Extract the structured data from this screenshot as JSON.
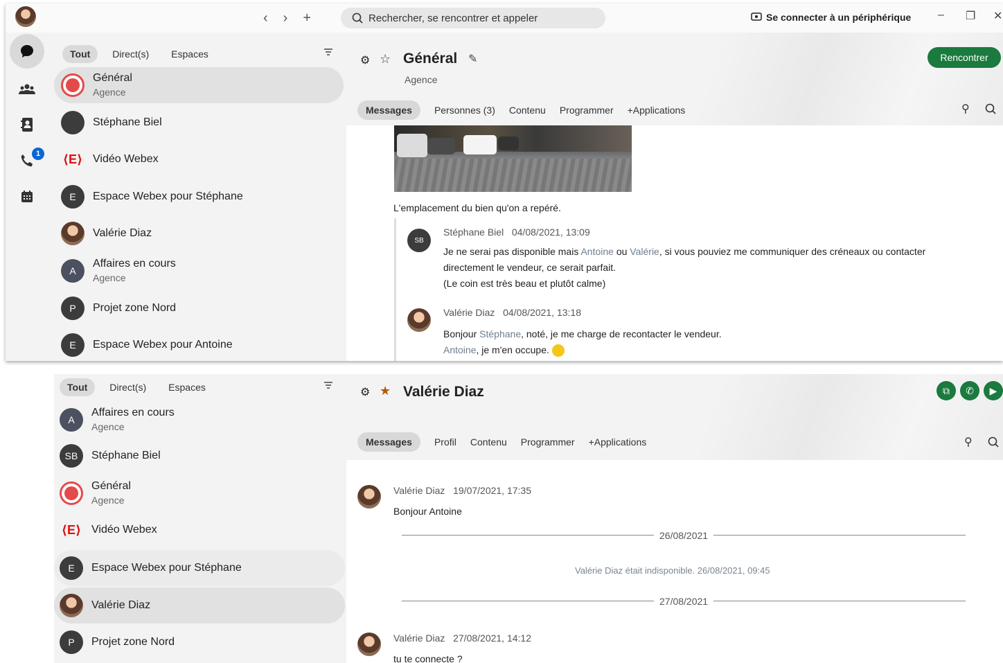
{
  "top": {
    "nav": {
      "back": "‹",
      "forward": "›",
      "add": "+"
    },
    "search_placeholder": "Rechercher, se rencontrer et appeler",
    "connect_label": "Se connecter à un périphérique",
    "win": {
      "min": "–",
      "max": "❐",
      "close": "✕"
    },
    "rail": {
      "calls_badge": "1"
    },
    "filters": {
      "all": "Tout",
      "direct": "Direct(s)",
      "spaces": "Espaces"
    },
    "list": [
      {
        "name": "Général",
        "sub": "Agence"
      },
      {
        "name": "Stéphane Biel",
        "sub": ""
      },
      {
        "name": "Vidéo Webex",
        "sub": ""
      },
      {
        "name": "Espace Webex pour Stéphane",
        "sub": "",
        "initial": "E"
      },
      {
        "name": "Valérie Diaz",
        "sub": ""
      },
      {
        "name": "Affaires en cours",
        "sub": "Agence",
        "initial": "A"
      },
      {
        "name": "Projet zone Nord",
        "sub": "",
        "initial": "P"
      },
      {
        "name": "Espace Webex pour Antoine",
        "sub": "",
        "initial": "E"
      }
    ],
    "header": {
      "title": "Général",
      "subtitle": "Agence",
      "meet": "Rencontrer"
    },
    "tabs": {
      "messages": "Messages",
      "people": "Personnes (3)",
      "content": "Contenu",
      "schedule": "Programmer",
      "apps": "+Applications"
    },
    "caption": "L'emplacement du bien qu'on a repéré.",
    "msg1": {
      "initials": "SB",
      "author": "Stéphane Biel",
      "time": "04/08/2021, 13:09",
      "l1a": "Je ne serai pas disponible mais ",
      "m1": "Antoine",
      "l1b": " ou ",
      "m2": "Valérie",
      "l1c": ", si vous pouviez me communiquer des créneaux ou contacter",
      "l2": "directement le vendeur, ce serait parfait.",
      "l3": "(Le coin est très beau et plutôt calme)"
    },
    "msg2": {
      "author": "Valérie Diaz",
      "time": "04/08/2021, 13:18",
      "l1a": "Bonjour ",
      "m1": "Stéphane",
      "l1b": ", noté, je me charge de recontacter le vendeur.",
      "m2": "Antoine",
      "l2b": ", je m'en occupe. "
    }
  },
  "bottom": {
    "filters": {
      "all": "Tout",
      "direct": "Direct(s)",
      "spaces": "Espaces"
    },
    "list": [
      {
        "name": "Affaires en cours",
        "sub": "Agence",
        "initial": "A"
      },
      {
        "name": "Stéphane Biel",
        "sub": "",
        "initial": "SB"
      },
      {
        "name": "Général",
        "sub": "Agence"
      },
      {
        "name": "Vidéo Webex",
        "sub": ""
      },
      {
        "name": "Espace Webex pour Stéphane",
        "sub": "",
        "initial": "E"
      },
      {
        "name": "Valérie Diaz",
        "sub": ""
      },
      {
        "name": "Projet zone Nord",
        "sub": "",
        "initial": "P"
      }
    ],
    "header": {
      "title": "Valérie Diaz"
    },
    "tabs": {
      "messages": "Messages",
      "profile": "Profil",
      "content": "Contenu",
      "schedule": "Programmer",
      "apps": "+Applications"
    },
    "msg1": {
      "author": "Valérie Diaz",
      "time": "19/07/2021, 17:35",
      "text": "Bonjour Antoine"
    },
    "date1": "26/08/2021",
    "status": "Valérie Diaz était indisponible. 26/08/2021, 09:45",
    "date2": "27/08/2021",
    "msg2": {
      "author": "Valérie Diaz",
      "time": "27/08/2021, 14:12",
      "text": "tu te connecte ?"
    }
  }
}
